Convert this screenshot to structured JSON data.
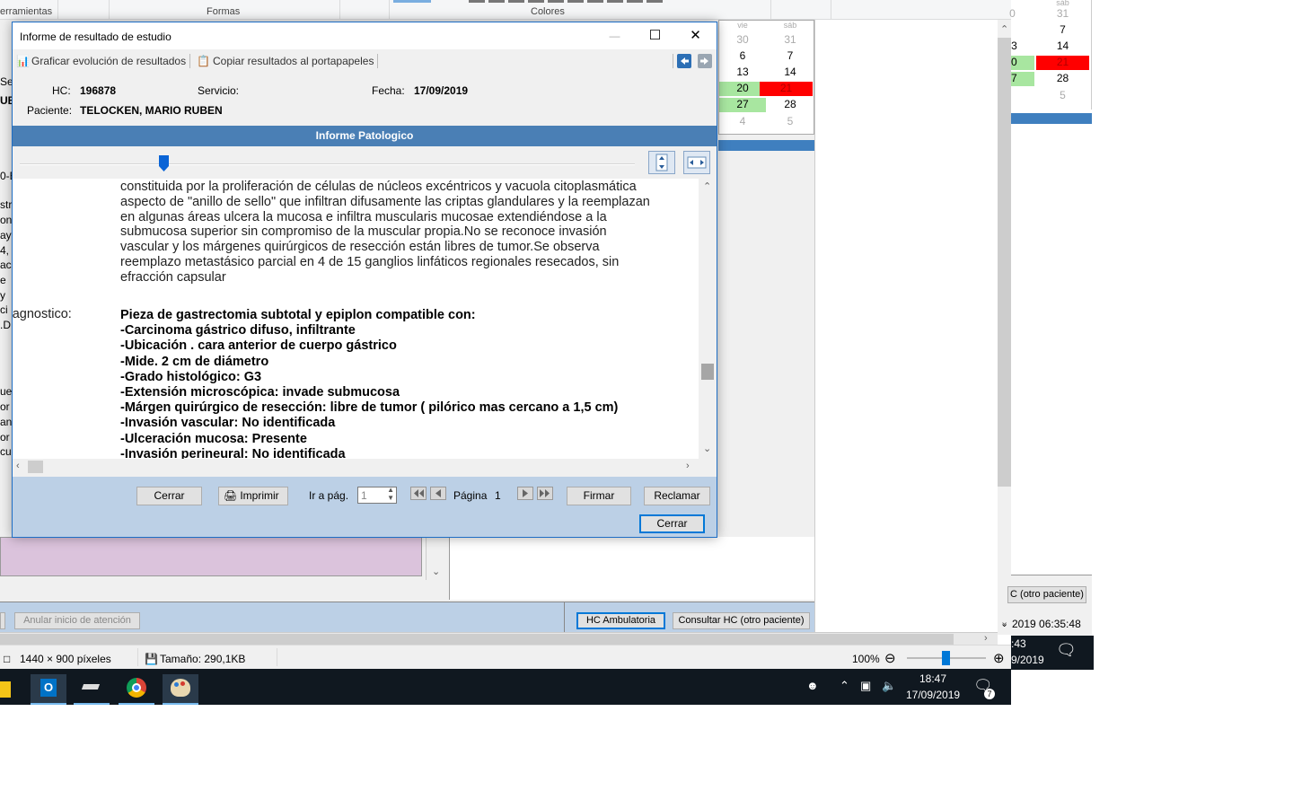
{
  "background": {
    "ribbon": {
      "groups": [
        "erramientas",
        "Formas",
        "Colores"
      ]
    },
    "left_fragments": [
      "Se",
      "UB",
      "0-E",
      "str",
      "on",
      "ay",
      "4,",
      "ac",
      "e",
      "y",
      "ci",
      ".D",
      "ue",
      "or",
      "an",
      "or",
      "cu"
    ],
    "left_diagnostico": "iagnostico:",
    "buttons": {
      "anular": "Anular inicio de atención",
      "hc_ambulatoria": "HC Ambulatoria",
      "consultar_hc": "Consultar HC (otro paciente)",
      "consultar_hc_right": "C (otro paciente)"
    },
    "calendar": {
      "headers": [
        "vie",
        "sáb"
      ],
      "rows": [
        [
          "30",
          "31"
        ],
        [
          "6",
          "7"
        ],
        [
          "13",
          "14"
        ],
        [
          "20",
          "21"
        ],
        [
          "27",
          "28"
        ],
        [
          "4",
          "5"
        ]
      ]
    },
    "calendar2": {
      "headers": [
        "",
        "sáb"
      ],
      "rows": [
        [
          "0",
          "31"
        ],
        [
          "",
          "7"
        ],
        [
          "3",
          "14"
        ],
        [
          "0",
          "21"
        ],
        [
          "7",
          "28"
        ],
        [
          "",
          "5"
        ]
      ]
    },
    "right_datetime": "2019  06:35:48",
    "right_time_fragment": ":43",
    "right_date_fragment": "9/2019",
    "status": {
      "dimensions": "1440 × 900 píxeles",
      "size": "Tamaño: 290,1KB",
      "zoom": "100%"
    },
    "taskbar": {
      "time": "18:47",
      "date": "17/09/2019",
      "notifications": "7"
    },
    "colors": {
      "green": "#a8e6a0",
      "red": "#ff0000",
      "blue_bar": "#4a7fb5",
      "footer_bg": "#bcd0e6"
    }
  },
  "dialog": {
    "title": "Informe de resultado de estudio",
    "window_controls": {
      "minimize": "—",
      "maximize": "☐",
      "close": "✕"
    },
    "toolbar": {
      "graph_label": "Graficar evolución de resultados",
      "copy_label": "Copiar resultados al portapapeles"
    },
    "info": {
      "hc_label": "HC:",
      "hc_value": "196878",
      "servicio_label": "Servicio:",
      "servicio_value": "",
      "fecha_label": "Fecha:",
      "fecha_value": "17/09/2019",
      "paciente_label": "Paciente:",
      "paciente_value": "TELOCKEN, MARIO RUBEN"
    },
    "section_title": "Informe Patologico",
    "report": {
      "paragraph_lines": [
        "constituida por la proliferación de células de núcleos excéntricos y vacuola citoplasmática",
        "aspecto de \"anillo de sello\" que infiltran difusamente las criptas glandulares y la reemplazan",
        "en algunas áreas ulcera la mucosa e infiltra muscularis mucosae extendiéndose a la",
        "submucosa superior sin compromiso de la muscular propia.No se reconoce invasión",
        "vascular y los márgenes quirúrgicos de resección están libres de tumor.Se observa",
        "reemplazo metastásico parcial en 4 de 15 ganglios linfáticos regionales resecados, sin",
        "efracción capsular"
      ],
      "diagnosis_label": "Diagnostico:",
      "diagnosis_lines": [
        "Pieza de gastrectomia subtotal y epiplon compatible con:",
        "-Carcinoma gástrico difuso, infiltrante",
        "-Ubicación . cara anterior de cuerpo gástrico",
        "-Mide. 2 cm de diámetro",
        "-Grado histológico: G3",
        "-Extensión microscópica: invade submucosa",
        "-Márgen quirúrgico de resección: libre de tumor ( pilórico mas cercano a 1,5 cm)",
        "-Invasión vascular: No identificada",
        "-Ulceración  mucosa: Presente",
        "-Invasión perineural: No identificada"
      ]
    },
    "footer": {
      "cerrar_left": "Cerrar",
      "imprimir": "Imprimir",
      "ir_a_pag": "Ir a pág.",
      "page_input": "1",
      "pagina_label": "Página",
      "pagina_value": "1",
      "firmar": "Firmar",
      "reclamar": "Reclamar",
      "cerrar_main": "Cerrar"
    }
  }
}
